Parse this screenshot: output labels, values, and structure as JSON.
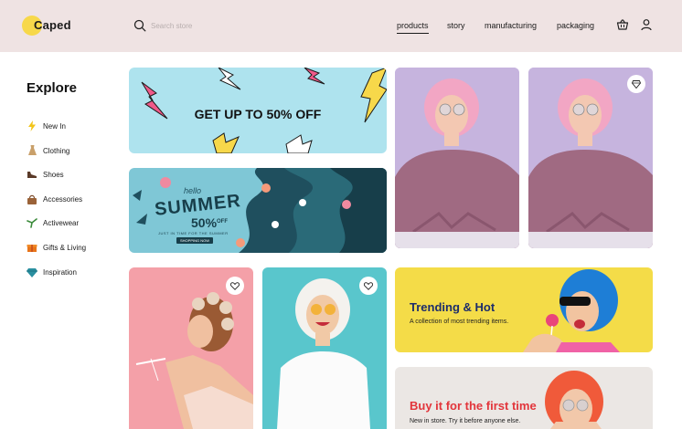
{
  "brand": {
    "name": "Caped"
  },
  "search": {
    "placeholder": "Search store"
  },
  "nav": [
    {
      "label": "products",
      "active": true
    },
    {
      "label": "story",
      "active": false
    },
    {
      "label": "manufacturing",
      "active": false
    },
    {
      "label": "packaging",
      "active": false
    }
  ],
  "sidebar": {
    "title": "Explore",
    "items": [
      {
        "label": "New In",
        "icon": "lightning-icon"
      },
      {
        "label": "Clothing",
        "icon": "dress-icon"
      },
      {
        "label": "Shoes",
        "icon": "shoe-icon"
      },
      {
        "label": "Accessories",
        "icon": "bag-icon"
      },
      {
        "label": "Activewear",
        "icon": "activewear-icon"
      },
      {
        "label": "Gifts & Living",
        "icon": "gift-icon"
      },
      {
        "label": "Inspiration",
        "icon": "diamond-icon"
      }
    ]
  },
  "banners": {
    "sale": {
      "text": "GET UP TO 50% OFF"
    },
    "summer": {
      "hello": "hello",
      "title": "SUMMER",
      "percent": "50%",
      "off": "OFF",
      "tagline": "JUST IN TIME FOR THE SUMMER",
      "button": "SHOPPING NOW"
    }
  },
  "promos": {
    "trending": {
      "title": "Trending & Hot",
      "subtitle": "A collection of most trending items."
    },
    "first_time": {
      "title": "Buy it for the first time",
      "subtitle": "New in store. Try it before anyone else."
    }
  },
  "colors": {
    "header_bg": "#efe3e3",
    "brand_yellow": "#f7d84a",
    "sale_bg": "#aee3ee",
    "summer_bg": "#1f4f5e",
    "trending_bg": "#f4dc48",
    "first_time_bg": "#ebe7e4",
    "first_time_title": "#e2353b",
    "trending_title": "#1d2d6b"
  }
}
